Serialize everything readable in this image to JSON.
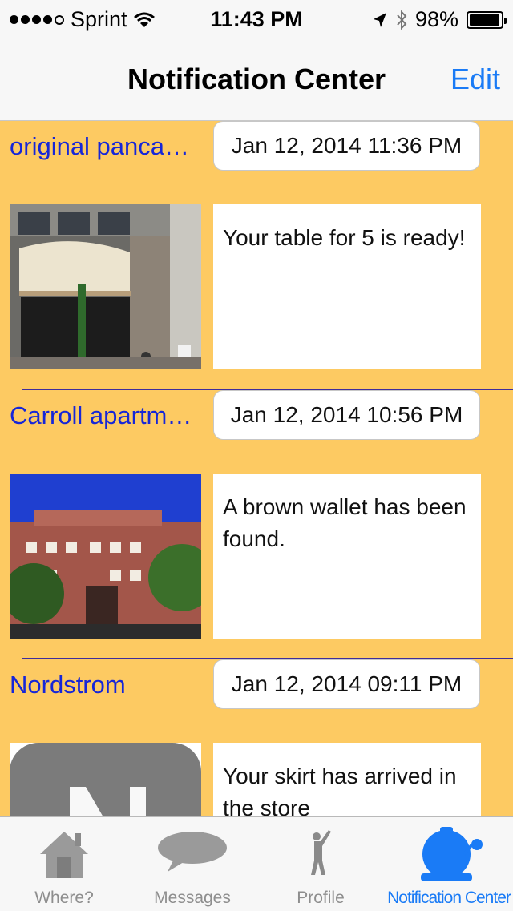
{
  "status_bar": {
    "carrier": "Sprint",
    "time": "11:43 PM",
    "battery": "98%",
    "battery_level": 0.98,
    "signal_bars": 4
  },
  "nav": {
    "title": "Notification Center",
    "edit_label": "Edit"
  },
  "notifications": [
    {
      "name": "original panca…",
      "date": "Jan 12, 2014 11:36 PM",
      "message": "Your table for 5 is ready!",
      "thumb": "pancake-house-storefront"
    },
    {
      "name": "Carroll apartm…",
      "date": "Jan 12, 2014 10:56 PM",
      "message": "A brown wallet has been found.",
      "thumb": "brick-apartment-building"
    },
    {
      "name": "Nordstrom",
      "date": "Jan 12, 2014 09:11 PM",
      "message": "Your skirt has arrived in the store",
      "thumb": "nordstrom-logo"
    }
  ],
  "tabs": [
    {
      "label": "Where?",
      "icon": "house-icon"
    },
    {
      "label": "Messages",
      "icon": "speech-bubble-icon"
    },
    {
      "label": "Profile",
      "icon": "person-icon"
    },
    {
      "label": "Notification Center",
      "icon": "bell-icon",
      "active": true
    }
  ],
  "colors": {
    "background": "#fdca62",
    "link": "#1626d8",
    "separator": "#3f2d9a",
    "accent": "#1a7bf6"
  }
}
